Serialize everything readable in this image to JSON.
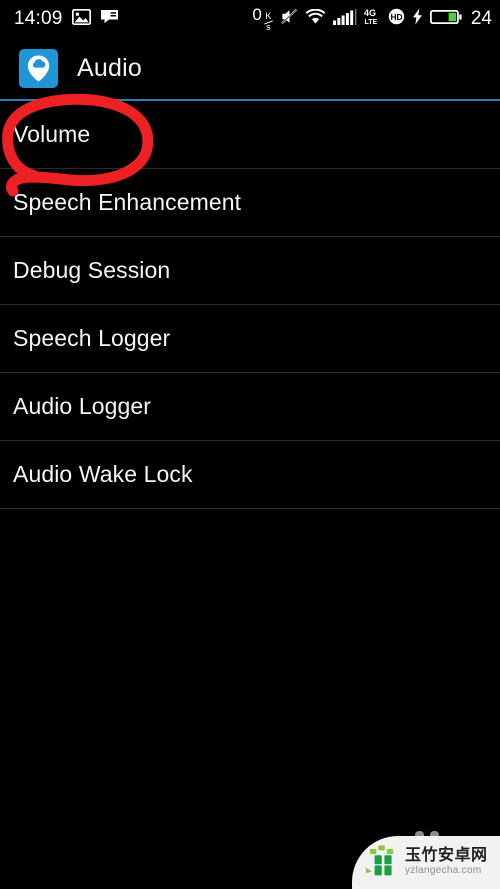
{
  "status_bar": {
    "clock": "14:09",
    "left_icons": [
      "image-icon",
      "message-icon"
    ],
    "network_speed": {
      "value": "0",
      "unit_top": "K",
      "unit_bottom": "s"
    },
    "right_icons": [
      "mute-icon",
      "wifi-icon",
      "signal-bars-icon",
      "4g-lte-icon",
      "hd-icon",
      "charging-bolt-icon",
      "battery-icon"
    ],
    "battery_percent": "24",
    "battery_level": 24
  },
  "header": {
    "app_name": "Audio",
    "app_icon": "cloud-pin-icon",
    "icon_bg_color": "#2196d6",
    "accent_color": "#2a7fb8"
  },
  "list": {
    "items": [
      {
        "label": "Volume",
        "name": "list-item-volume",
        "annotated": true
      },
      {
        "label": "Speech Enhancement",
        "name": "list-item-speech-enhancement",
        "annotated": false
      },
      {
        "label": "Debug Session",
        "name": "list-item-debug-session",
        "annotated": false
      },
      {
        "label": "Speech Logger",
        "name": "list-item-speech-logger",
        "annotated": false
      },
      {
        "label": "Audio Logger",
        "name": "list-item-audio-logger",
        "annotated": false
      },
      {
        "label": "Audio Wake Lock",
        "name": "list-item-audio-wake-lock",
        "annotated": false
      }
    ]
  },
  "annotation": {
    "shape": "hand-drawn-ellipse",
    "color": "#ed2024",
    "target": "Volume"
  },
  "watermark": {
    "title": "玉竹安卓网",
    "url": "yzlangecha.com",
    "logo": "bamboo-logo-icon"
  }
}
